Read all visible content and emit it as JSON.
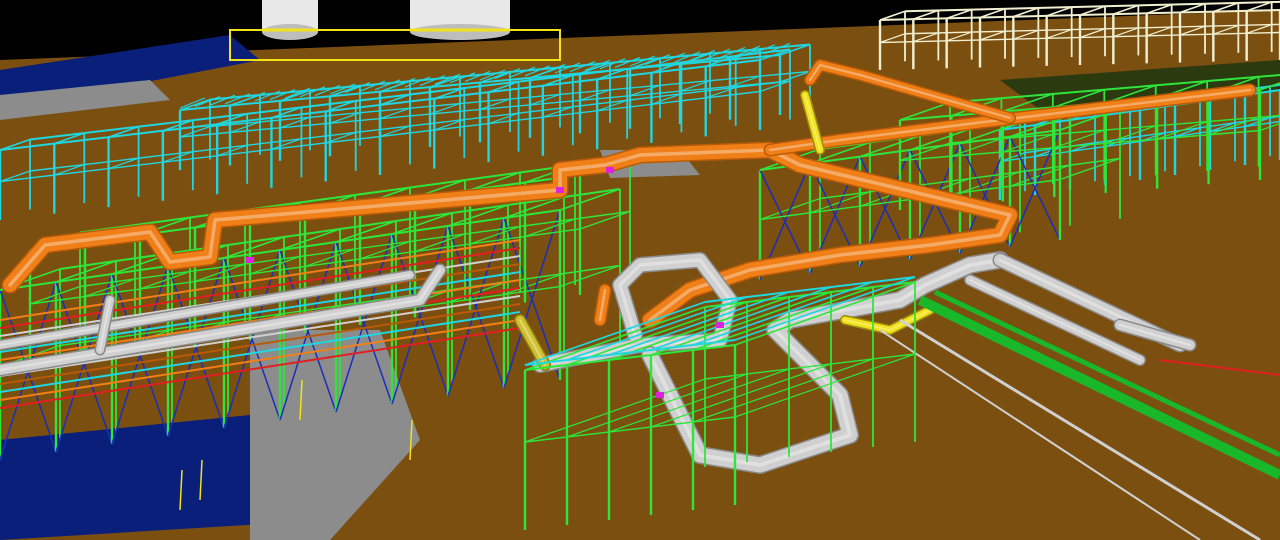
{
  "viewport": {
    "kind": "3d-plant-model-view",
    "colors": {
      "sky": "#000000",
      "ground": "#7a4f10",
      "paving": "#8c8c8c",
      "water": "#0a1f7a",
      "steel_primary": "#2ee63a",
      "steel_secondary": "#20d6e0",
      "bracing": "#1a2fb8",
      "pipe_main": "#f07f18",
      "pipe_main_shadow": "#b85a08",
      "pipe_grey": "#d0d0d0",
      "pipe_grey_shadow": "#8a8a8a",
      "pipe_yellow": "#f2e21a",
      "pipe_green": "#18b82a",
      "tank": "#e8e8e8",
      "accent_magenta": "#e020e0",
      "accent_red": "#e02020",
      "accent_white": "#ffffff"
    },
    "objects": [
      {
        "name": "storage-tank",
        "count": 2
      },
      {
        "name": "pipe-rack",
        "count": 4
      },
      {
        "name": "main-process-pipe",
        "color": "orange"
      },
      {
        "name": "utility-pipe",
        "color": "grey"
      },
      {
        "name": "small-bore-pipe",
        "color": "yellow"
      },
      {
        "name": "ground-pipe",
        "color": "green"
      }
    ]
  }
}
